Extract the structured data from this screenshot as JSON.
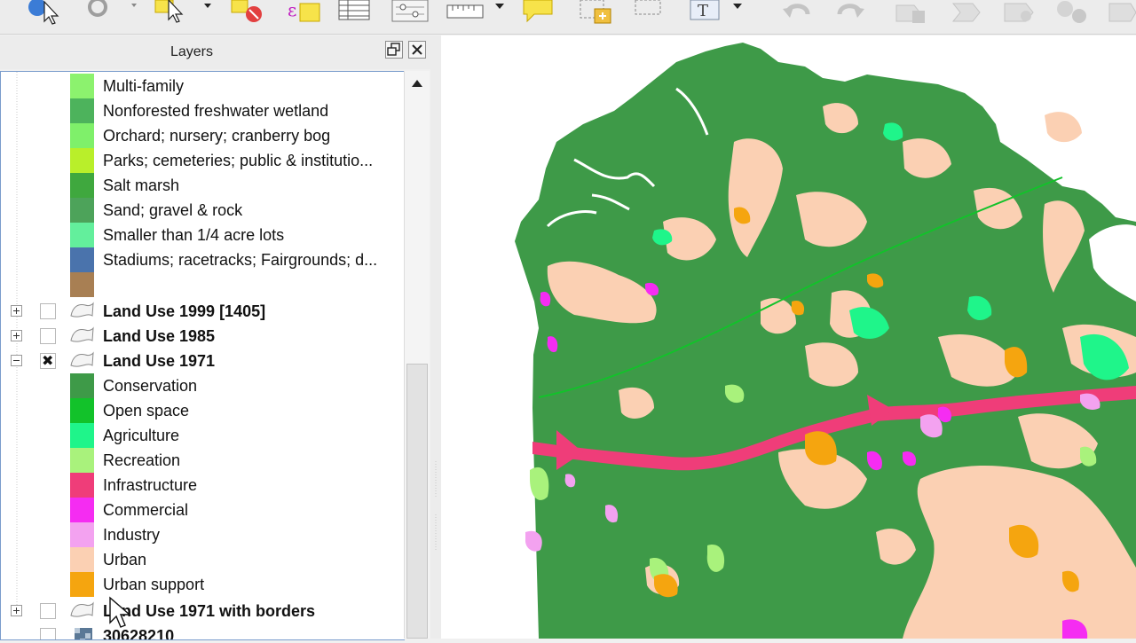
{
  "toolbar": {
    "tools": [
      "identify-icon",
      "select-features-icon",
      "select-rectangle-icon",
      "deselect-icon",
      "select-by-expression-icon",
      "attribute-table-icon",
      "field-calculator-icon",
      "measure-icon",
      "annotation-icon",
      "new-bookmark-icon",
      "pan-to-selection-icon",
      "text-label-icon",
      "undo-icon",
      "redo-icon",
      "rotate-label-icon",
      "move-label-icon",
      "pin-label-icon",
      "settings-icon",
      "settings-gear-icon"
    ]
  },
  "layers_panel": {
    "title": "Layers",
    "legend_top": [
      {
        "label": "Multi-family",
        "color": "#8cf26e"
      },
      {
        "label": "Nonforested freshwater wetland",
        "color": "#4db35c"
      },
      {
        "label": "Orchard; nursery; cranberry bog",
        "color": "#7ff06a"
      },
      {
        "label": "Parks; cemeteries; public & institutio...",
        "color": "#b9ef2a"
      },
      {
        "label": "Salt marsh",
        "color": "#3fa83e"
      },
      {
        "label": "Sand; gravel & rock",
        "color": "#4da35a"
      },
      {
        "label": "Smaller than 1/4 acre lots",
        "color": "#63ef9c"
      },
      {
        "label": "Stadiums; racetracks; Fairgrounds; d...",
        "color": "#4a73ac"
      },
      {
        "label": "",
        "color": "#a87f53"
      }
    ],
    "layers": [
      {
        "name": "Land Use 1999 [1405]",
        "checked": false,
        "expanded": false
      },
      {
        "name": "Land Use 1985",
        "checked": false,
        "expanded": false
      },
      {
        "name": "Land Use 1971",
        "checked": true,
        "expanded": true
      }
    ],
    "legend_1971": [
      {
        "label": "Conservation",
        "color": "#3e9a48"
      },
      {
        "label": "Open space",
        "color": "#12c22a"
      },
      {
        "label": "Agriculture",
        "color": "#1ff58a"
      },
      {
        "label": "Recreation",
        "color": "#a9f27c"
      },
      {
        "label": "Infrastructure",
        "color": "#ef3d79"
      },
      {
        "label": "Commercial",
        "color": "#f52cf2"
      },
      {
        "label": "Industry",
        "color": "#f3a2f0"
      },
      {
        "label": "Urban",
        "color": "#fbd0b3"
      },
      {
        "label": "Urban support",
        "color": "#f5a50f"
      }
    ],
    "layers_bottom": [
      {
        "name": "Land Use 1971 with borders",
        "checked": false,
        "expanded": false
      },
      {
        "name": "30628210",
        "checked": false,
        "expanded": false
      }
    ]
  },
  "map": {
    "colors": {
      "conservation": "#3e9a48",
      "urban": "#fbd0b3",
      "infrastructure": "#ef3d79",
      "agriculture": "#1ff58a",
      "urban_support": "#f5a50f",
      "commercial": "#f52cf2",
      "industry": "#f3a2f0",
      "recreation": "#a9f27c",
      "open_space": "#12c22a"
    }
  }
}
